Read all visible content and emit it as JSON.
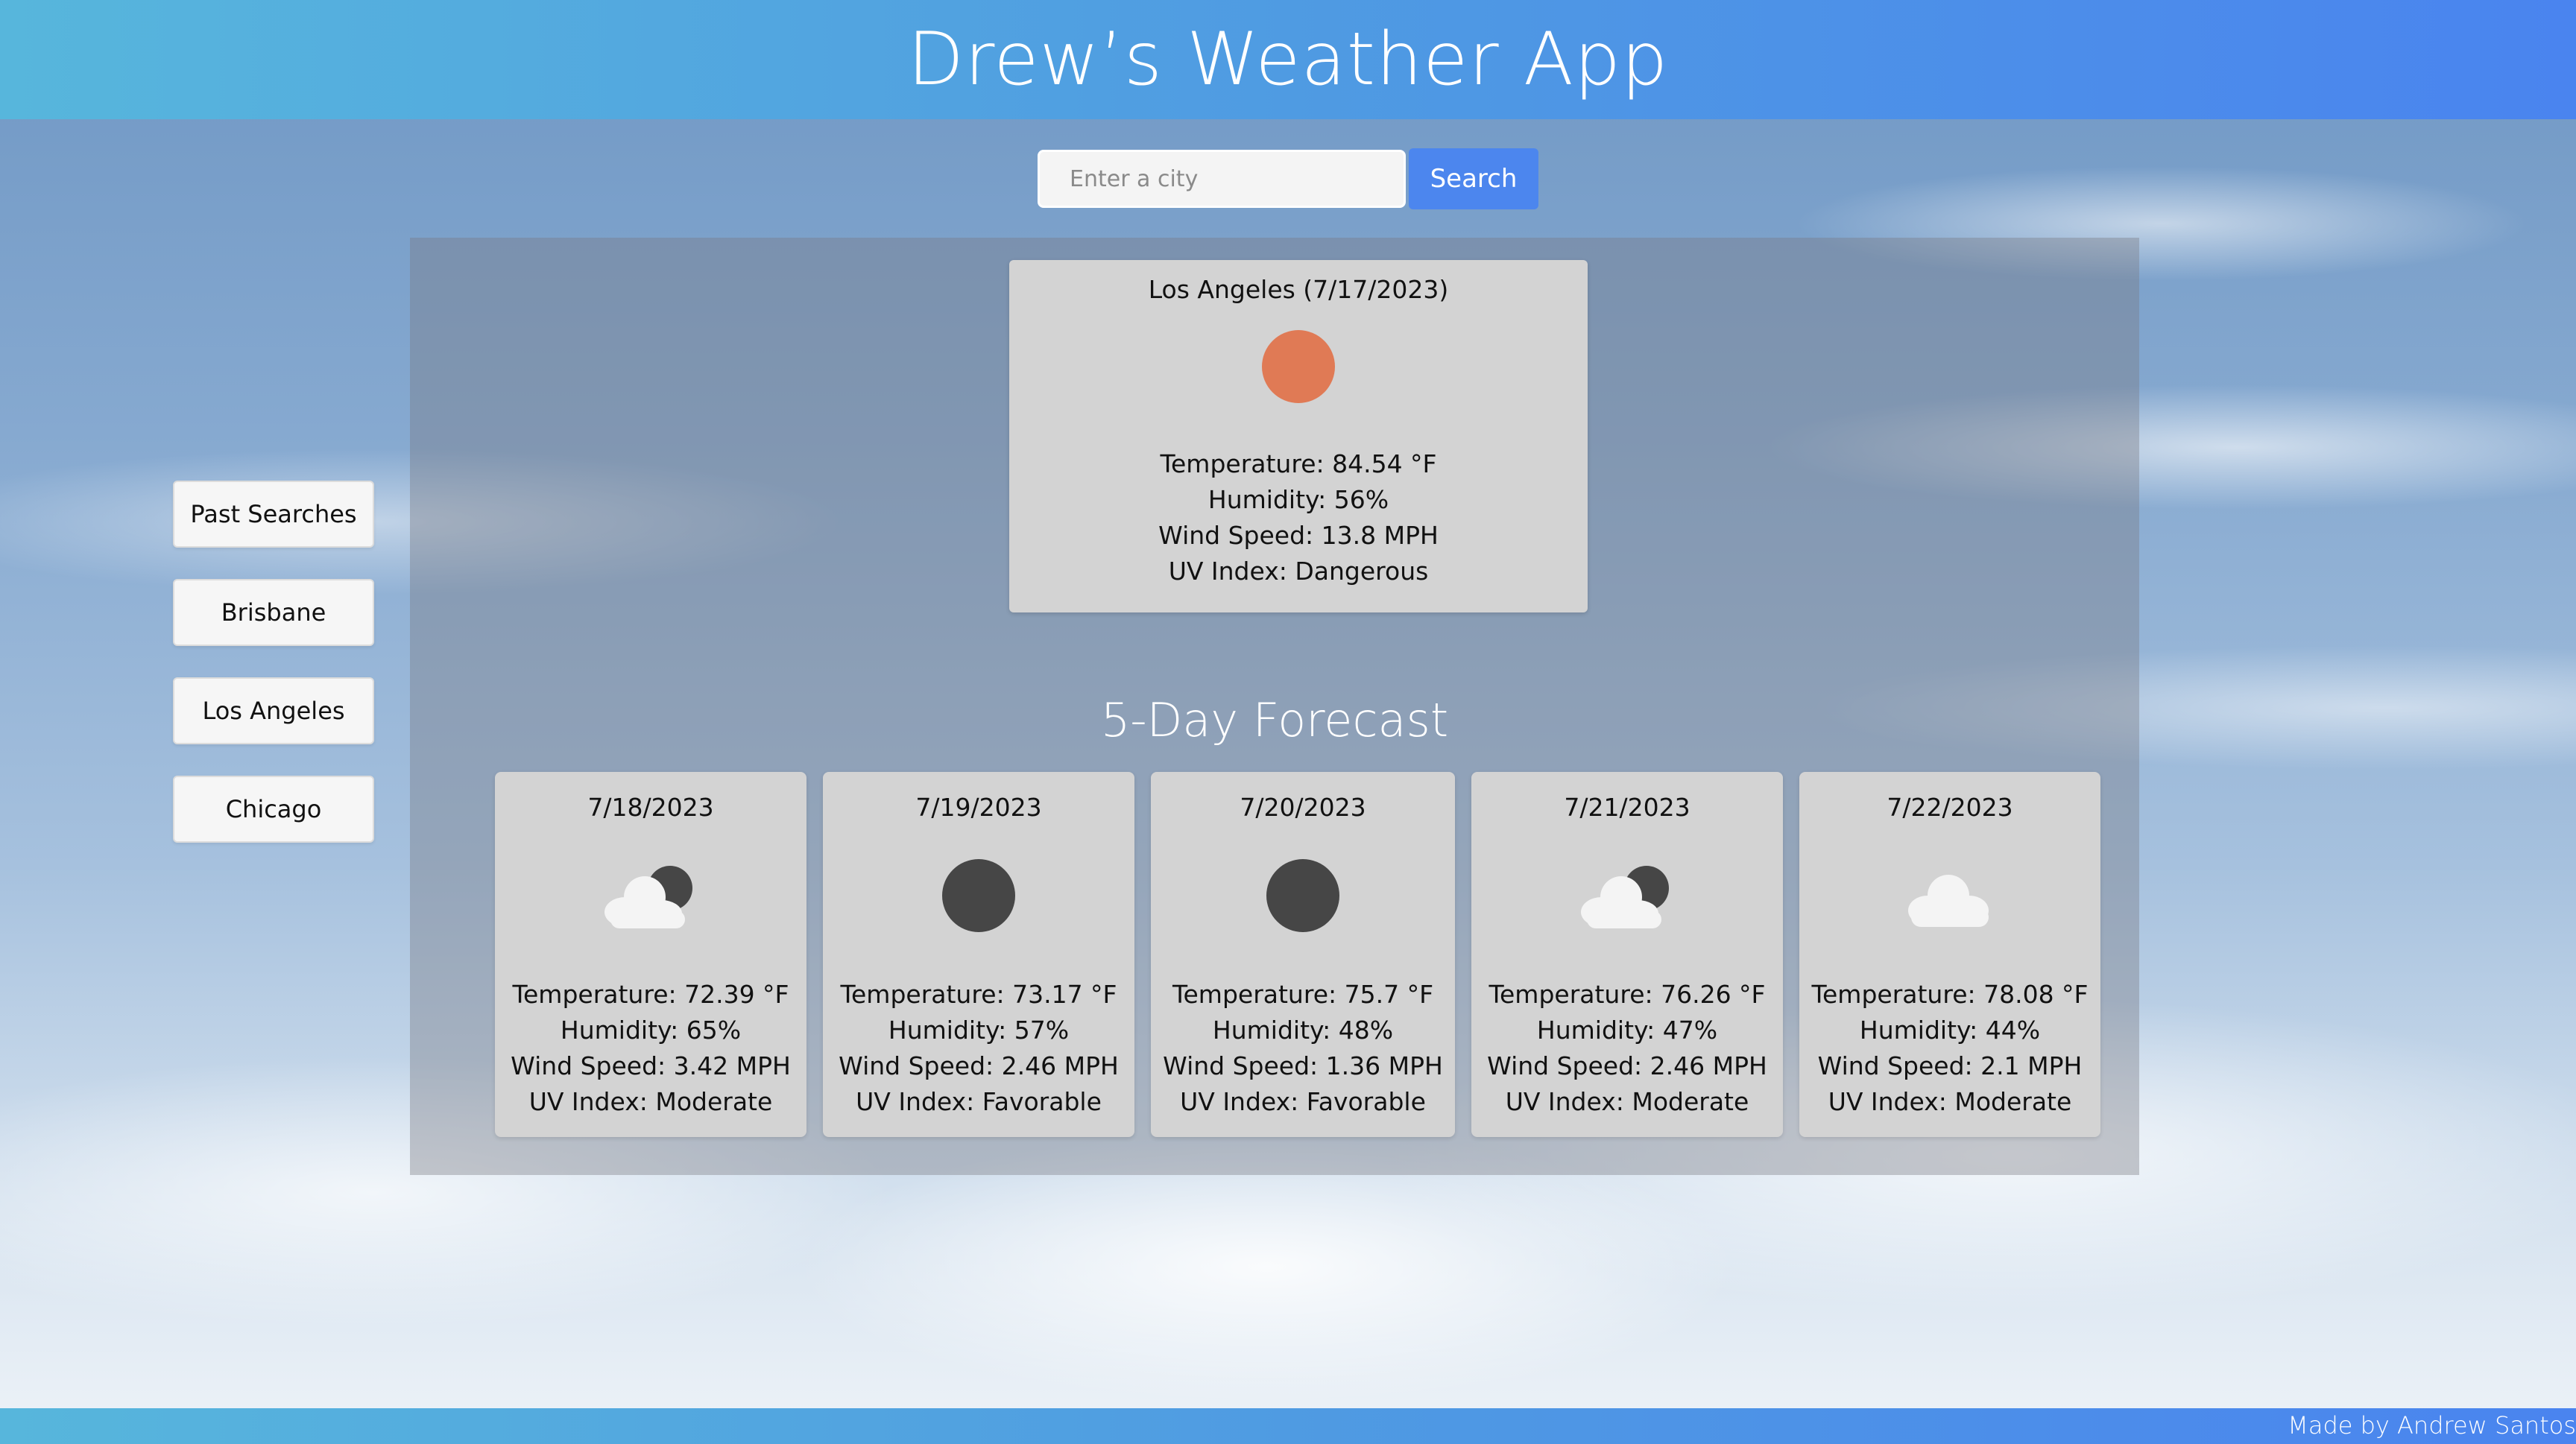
{
  "app": {
    "title": "Drew’s Weather App"
  },
  "search": {
    "placeholder": "Enter a city",
    "value": "",
    "button_label": "Search"
  },
  "sidebar": {
    "items": [
      {
        "label": "Past Searches"
      },
      {
        "label": "Brisbane"
      },
      {
        "label": "Los Angeles"
      },
      {
        "label": "Chicago"
      }
    ]
  },
  "current": {
    "heading": "Los Angeles (7/17/2023)",
    "icon": "clear-day-sun-icon",
    "temperature": "Temperature: 84.54 °F",
    "humidity": "Humidity: 56%",
    "wind": "Wind Speed: 13.8 MPH",
    "uv": "UV Index: Dangerous"
  },
  "forecast": {
    "title": "5-Day Forecast",
    "days": [
      {
        "date": "7/18/2023",
        "icon": "partly-cloudy-night-icon",
        "temperature": "Temperature: 72.39 °F",
        "humidity": "Humidity: 65%",
        "wind": "Wind Speed: 3.42 MPH",
        "uv": "UV Index: Moderate"
      },
      {
        "date": "7/19/2023",
        "icon": "clear-night-icon",
        "temperature": "Temperature: 73.17 °F",
        "humidity": "Humidity: 57%",
        "wind": "Wind Speed: 2.46 MPH",
        "uv": "UV Index: Favorable"
      },
      {
        "date": "7/20/2023",
        "icon": "clear-night-icon",
        "temperature": "Temperature: 75.7 °F",
        "humidity": "Humidity: 48%",
        "wind": "Wind Speed: 1.36 MPH",
        "uv": "UV Index: Favorable"
      },
      {
        "date": "7/21/2023",
        "icon": "partly-cloudy-night-icon",
        "temperature": "Temperature: 76.26 °F",
        "humidity": "Humidity: 47%",
        "wind": "Wind Speed: 2.46 MPH",
        "uv": "UV Index: Moderate"
      },
      {
        "date": "7/22/2023",
        "icon": "cloud-icon",
        "temperature": "Temperature: 78.08 °F",
        "humidity": "Humidity: 44%",
        "wind": "Wind Speed: 2.1 MPH",
        "uv": "UV Index: Moderate"
      }
    ]
  },
  "footer": {
    "credit": "Made by Andrew Santos"
  },
  "colors": {
    "header_gradient_start": "#57b6dc",
    "header_gradient_end": "#4a84ef",
    "button_blue": "#4c86ee",
    "sun_orange": "#e07a55",
    "moon_dark": "#464646",
    "card_gray": "#d3d3d3"
  }
}
